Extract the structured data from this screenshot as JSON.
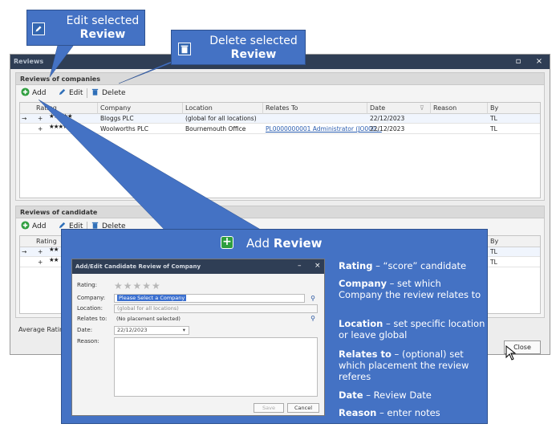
{
  "window": {
    "title": "Reviews",
    "maximize_glyph": "▫",
    "close_glyph": "×"
  },
  "companies_panel": {
    "header": "Reviews of companies",
    "toolbar": {
      "add": "Add",
      "edit": "Edit",
      "delete": "Delete"
    },
    "columns": [
      "Rating",
      "Company",
      "Location",
      "Relates To",
      "Date",
      "Reason",
      "By"
    ],
    "rows": [
      {
        "selected": true,
        "stars": "★★★★★",
        "company": "Bloggs PLC",
        "location": "(global for all locations)",
        "relates_to": "",
        "date": "22/12/2023",
        "reason": "",
        "by": "TL"
      },
      {
        "selected": false,
        "stars": "★★★★★",
        "company": "Woolworths PLC",
        "location": "Bournemouth Office",
        "relates_to": "PL0000000001 Administrator (JO000...",
        "date": "22/12/2023",
        "reason": "",
        "by": "TL"
      }
    ]
  },
  "candidate_panel": {
    "header": "Reviews of candidate",
    "toolbar": {
      "add": "Add",
      "edit": "Edit",
      "delete": "Delete"
    },
    "columns": {
      "rating": "Rating",
      "by": "By"
    },
    "rows": [
      {
        "selected": true,
        "stars": "★★",
        "by": "TL"
      },
      {
        "selected": false,
        "stars": "★★",
        "by": "TL"
      }
    ]
  },
  "footer": {
    "average_rating_label": "Average Rating:",
    "close_button": "Close"
  },
  "callouts": {
    "edit": {
      "line1": "Edit selected",
      "line2": "Review"
    },
    "delete": {
      "line1": "Delete selected",
      "line2": "Review"
    },
    "add": {
      "prefix": "Add ",
      "bold": "Review"
    }
  },
  "dialog": {
    "title": "Add/Edit Candidate Review of Company",
    "minimize_glyph": "–",
    "close_glyph": "×",
    "labels": {
      "rating": "Rating:",
      "company": "Company:",
      "location": "Location:",
      "relates_to": "Relates to:",
      "date": "Date:",
      "reason": "Reason:"
    },
    "rating_stars": "★★★★★",
    "company_value": "Please Select a Company",
    "location_value": "(global for all locations)",
    "relates_to_value": "(No placement selected)",
    "date_value": "22/12/2023",
    "reason_value": "",
    "save_button": "Save",
    "cancel_button": "Cancel"
  },
  "help": [
    {
      "term": "Rating",
      "desc": " – “score” candidate"
    },
    {
      "term": "Company",
      "desc": " – set which Company the review relates to"
    },
    {
      "term": "Location",
      "desc": " – set specific location or leave global"
    },
    {
      "term": "Relates to",
      "desc": "  – (optional) set which placement the review referes"
    },
    {
      "term": "Date",
      "desc": " – Review Date"
    },
    {
      "term": "Reason",
      "desc": " – enter notes"
    }
  ],
  "colors": {
    "callout_blue": "#4472c4",
    "titlebar": "#2f3e55",
    "star_blue": "#1f4e9c",
    "add_green": "#2e9e3e",
    "delete_blue": "#2f6fb8",
    "edit_blue": "#2f6fb8"
  },
  "icons": [
    "add-icon",
    "pencil-icon",
    "trash-icon",
    "binoculars-icon",
    "calendar-dropdown-icon",
    "cursor-icon"
  ]
}
